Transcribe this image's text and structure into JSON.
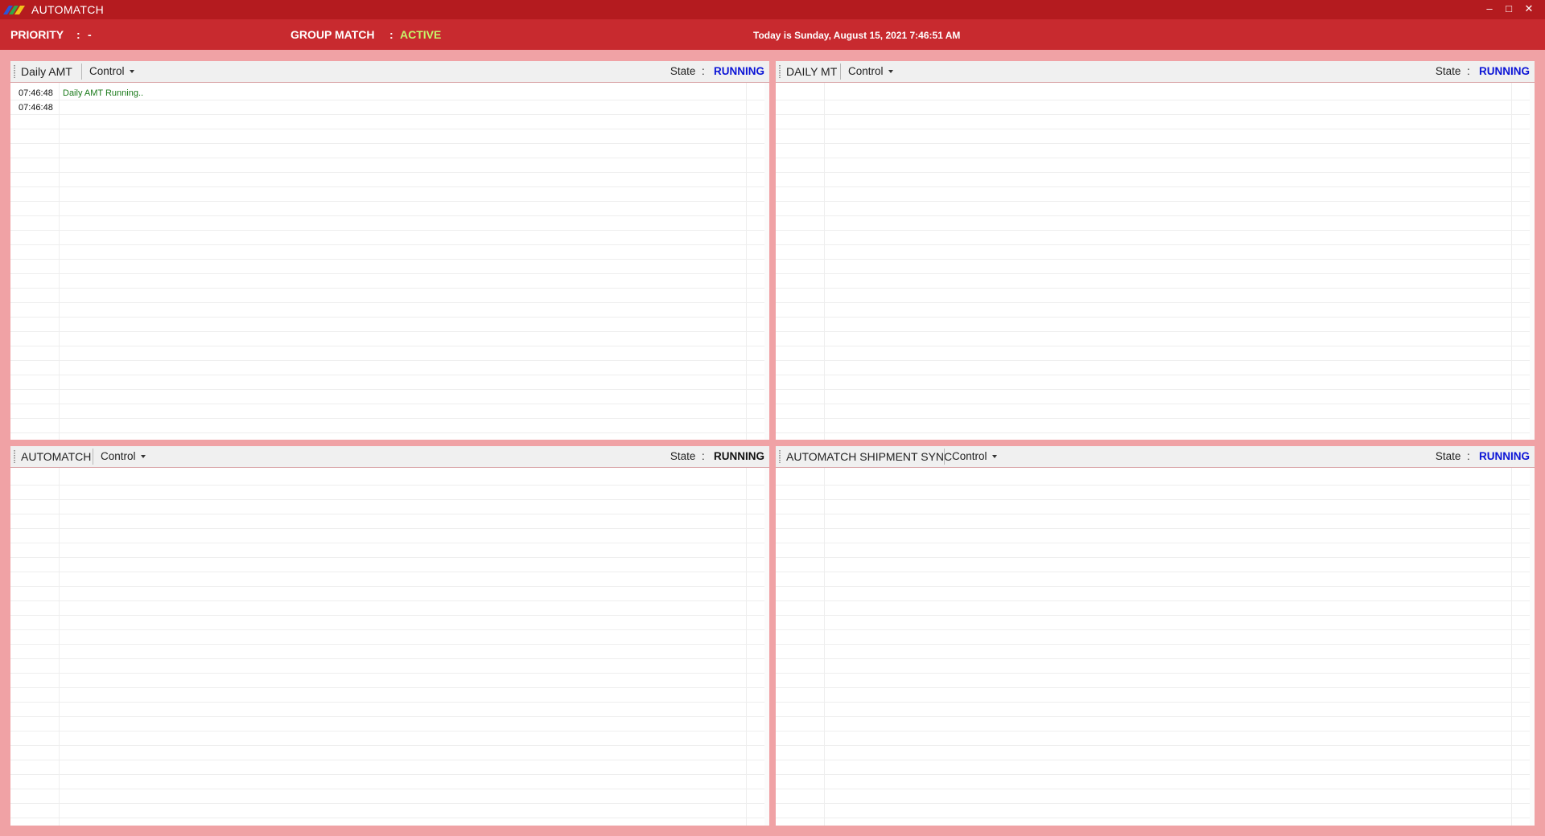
{
  "window": {
    "title": "AUTOMATCH",
    "minimize": "–",
    "maximize": "□",
    "close": "✕"
  },
  "status": {
    "priority_label": "PRIORITY",
    "priority_sep": ":",
    "priority_value": "-",
    "group_label": "GROUP MATCH",
    "group_sep": ":",
    "group_value": "ACTIVE",
    "date_text": "Today is Sunday, August 15, 2021 7:46:51 AM"
  },
  "panels": [
    {
      "title": "Daily AMT",
      "control": "Control",
      "state_label": "State",
      "state_sep": ":",
      "state_value": "RUNNING",
      "state_color": "#0b14d6",
      "log": [
        {
          "time": "07:46:48",
          "message": "Daily AMT Running.."
        },
        {
          "time": "07:46:48",
          "message": ""
        }
      ]
    },
    {
      "title": "DAILY MT",
      "control": "Control",
      "state_label": "State",
      "state_sep": ":",
      "state_value": "RUNNING",
      "state_color": "#0b14d6",
      "log": []
    },
    {
      "title": "AUTOMATCH",
      "control": "Control",
      "state_label": "State",
      "state_sep": ":",
      "state_value": "RUNNING",
      "state_color": "#111111",
      "log": []
    },
    {
      "title": "AUTOMATCH SHIPMENT SYNC",
      "control": "Control",
      "state_label": "State",
      "state_sep": ":",
      "state_value": "RUNNING",
      "state_color": "#0b14d6",
      "log": []
    }
  ]
}
